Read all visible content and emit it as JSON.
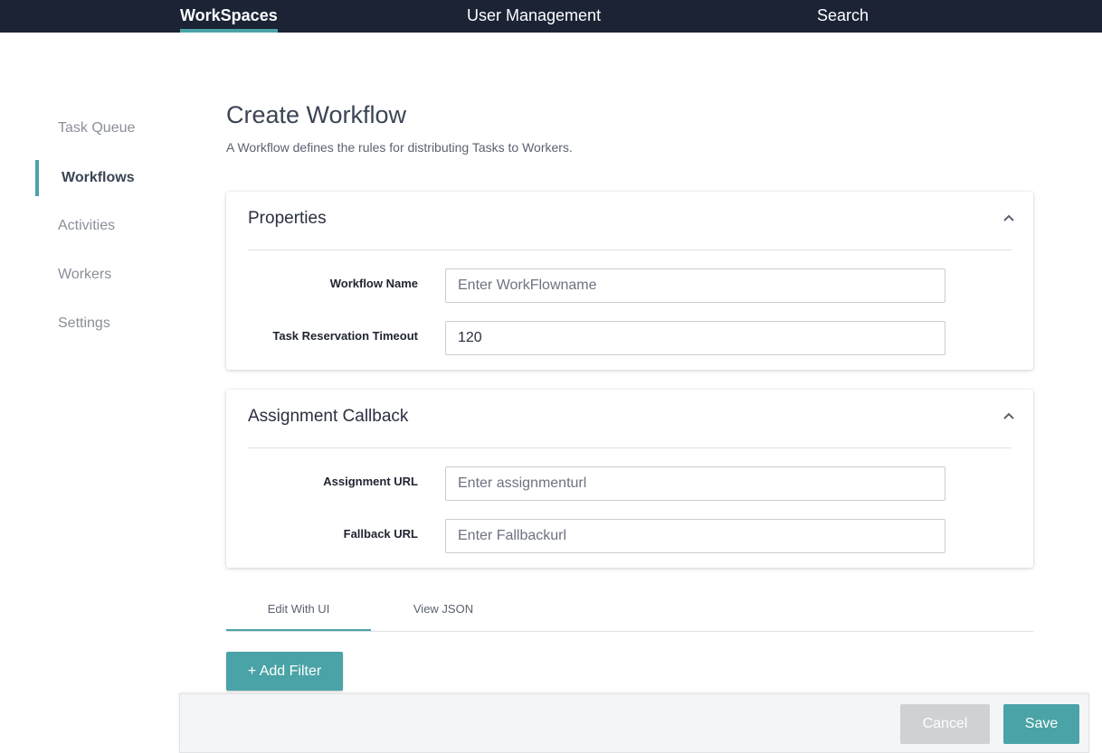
{
  "topnav": {
    "tabs": [
      {
        "label": "WorkSpaces"
      },
      {
        "label": "User Management"
      },
      {
        "label": "Search"
      }
    ]
  },
  "sidebar": {
    "items": [
      {
        "label": "Task Queue"
      },
      {
        "label": "Workflows"
      },
      {
        "label": "Activities"
      },
      {
        "label": "Workers"
      },
      {
        "label": "Settings"
      }
    ],
    "active": "Workflows"
  },
  "page": {
    "title": "Create Workflow",
    "description": "A Workflow defines the rules for distributing Tasks to Workers."
  },
  "properties": {
    "title": "Properties",
    "workflow_name_label": "Workflow Name",
    "workflow_name_placeholder": "Enter WorkFlowname",
    "workflow_name_value": "",
    "timeout_label": "Task Reservation Timeout",
    "timeout_value": "120"
  },
  "callback": {
    "title": "Assignment Callback",
    "assignment_url_label": "Assignment URL",
    "assignment_url_placeholder": "Enter assignmenturl",
    "fallback_url_label": "Fallback URL",
    "fallback_url_placeholder": "Enter Fallbackurl"
  },
  "editor_tabs": {
    "items": [
      {
        "label": "Edit With UI"
      },
      {
        "label": "View JSON"
      }
    ],
    "active": "Edit With UI"
  },
  "actions": {
    "add_filter_label": "+ Add Filter",
    "cancel_label": "Cancel",
    "save_label": "Save"
  },
  "colors": {
    "nav_background": "#1b2335",
    "accent": "#4aa3a6",
    "disabled_button": "#cfd1d4"
  },
  "icons": {
    "collapse": "chevron-up-icon"
  }
}
